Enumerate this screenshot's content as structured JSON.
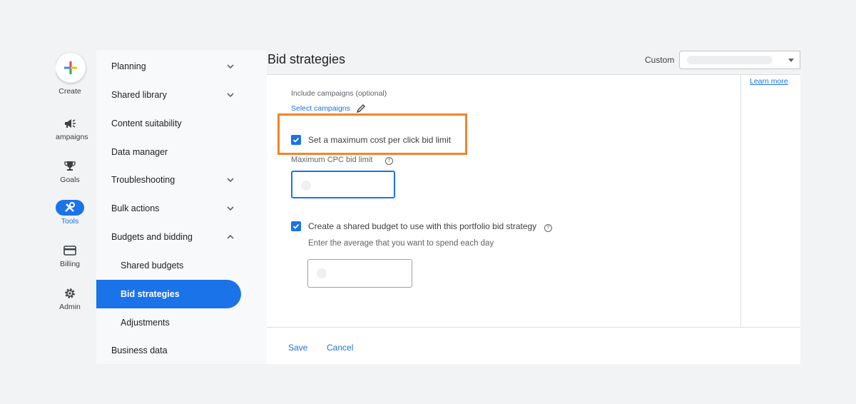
{
  "rail": {
    "create": "Create",
    "items": [
      {
        "label": "ampaigns",
        "icon": "megaphone-icon"
      },
      {
        "label": "Goals",
        "icon": "trophy-icon"
      },
      {
        "label": "Tools",
        "icon": "tools-icon"
      },
      {
        "label": "Billing",
        "icon": "credit-card-icon"
      },
      {
        "label": "Admin",
        "icon": "gear-icon"
      }
    ]
  },
  "nav": {
    "items": [
      {
        "label": "Planning"
      },
      {
        "label": "Shared library"
      },
      {
        "label": "Content suitability"
      },
      {
        "label": "Data manager"
      },
      {
        "label": "Troubleshooting"
      },
      {
        "label": "Bulk actions"
      },
      {
        "label": "Budgets and bidding"
      },
      {
        "label": "Shared budgets"
      },
      {
        "label": "Bid strategies"
      },
      {
        "label": "Adjustments"
      },
      {
        "label": "Business data"
      }
    ]
  },
  "header": {
    "title": "Bid strategies",
    "date_range_label": "Custom"
  },
  "side_panel": {
    "learn_more": "Learn more"
  },
  "form": {
    "include_campaigns_label": "Include campaigns (optional)",
    "select_campaigns_link": "Select campaigns",
    "max_cpc_checkbox_label": "Set a maximum cost per click bid limit",
    "max_cpc_field_label": "Maximum CPC bid limit",
    "shared_budget_checkbox_label": "Create a shared budget to use with this portfolio bid strategy",
    "shared_budget_hint": "Enter the average that you want to spend each day",
    "help_glyph": "?"
  },
  "footer": {
    "save": "Save",
    "cancel": "Cancel"
  },
  "colors": {
    "accent": "#1a73e8",
    "highlight": "#f4842c"
  }
}
